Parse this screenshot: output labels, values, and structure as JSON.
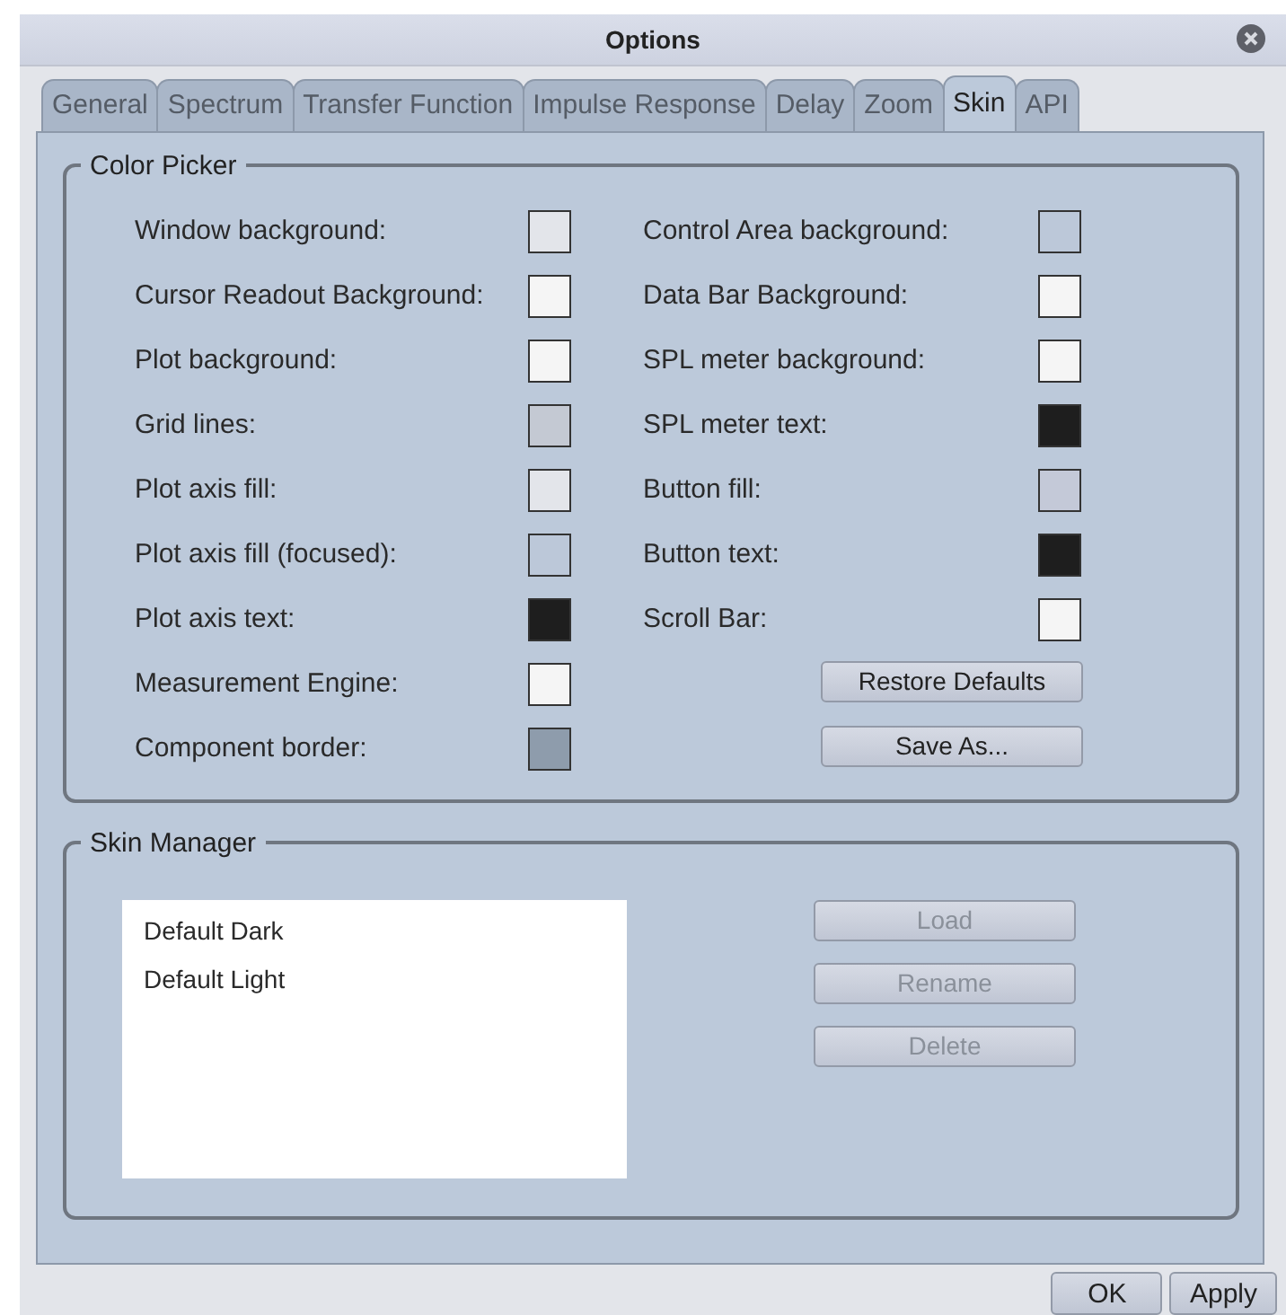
{
  "window": {
    "title": "Options"
  },
  "tabs": [
    {
      "label": "General",
      "selected": false
    },
    {
      "label": "Spectrum",
      "selected": false
    },
    {
      "label": "Transfer Function",
      "selected": false
    },
    {
      "label": "Impulse Response",
      "selected": false
    },
    {
      "label": "Delay",
      "selected": false
    },
    {
      "label": "Zoom",
      "selected": false
    },
    {
      "label": "Skin",
      "selected": true
    },
    {
      "label": "API",
      "selected": false
    }
  ],
  "color_picker": {
    "title": "Color Picker",
    "left": [
      {
        "label": "Window background:",
        "color": "#e3e5ea"
      },
      {
        "label": "Cursor Readout Background:",
        "color": "#f5f5f5"
      },
      {
        "label": "Plot background:",
        "color": "#f5f5f5"
      },
      {
        "label": "Grid lines:",
        "color": "#c4c9d3"
      },
      {
        "label": "Plot axis fill:",
        "color": "#e3e5ea"
      },
      {
        "label": "Plot axis fill (focused):",
        "color": "#bcc8d9"
      },
      {
        "label": "Plot axis text:",
        "color": "#1e1e1e"
      },
      {
        "label": "Measurement Engine:",
        "color": "#f5f5f5"
      },
      {
        "label": "Component border:",
        "color": "#8e9cac"
      }
    ],
    "right": [
      {
        "label": "Control Area background:",
        "color": "#bcc8d9"
      },
      {
        "label": "Data Bar Background:",
        "color": "#f5f5f5"
      },
      {
        "label": "SPL meter background:",
        "color": "#f5f5f5"
      },
      {
        "label": "SPL meter text:",
        "color": "#1e1e1e"
      },
      {
        "label": "Button fill:",
        "color": "#c4c9d8"
      },
      {
        "label": "Button text:",
        "color": "#1e1e1e"
      },
      {
        "label": "Scroll Bar:",
        "color": "#f5f5f5"
      }
    ],
    "buttons": [
      {
        "label": "Restore Defaults"
      },
      {
        "label": "Save As..."
      }
    ]
  },
  "skin_manager": {
    "title": "Skin Manager",
    "skins": [
      {
        "name": "Default Dark",
        "selected": false
      },
      {
        "name": "Default Light",
        "selected": false
      }
    ],
    "buttons": [
      {
        "label": "Load",
        "disabled": true
      },
      {
        "label": "Rename",
        "disabled": true
      },
      {
        "label": "Delete",
        "disabled": true
      }
    ]
  },
  "footer_buttons": [
    {
      "label": "OK"
    },
    {
      "label": "Apply"
    }
  ]
}
